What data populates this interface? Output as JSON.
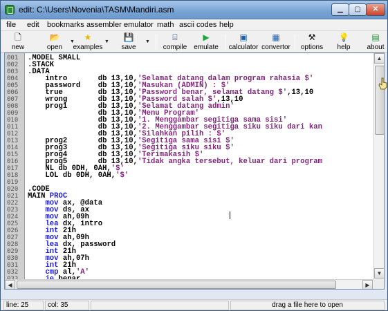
{
  "window": {
    "title": "edit: C:\\Users\\Novenia\\TASM\\Mandiri.asm",
    "minimize_icon": "minimize-icon",
    "maximize_icon": "maximize-icon",
    "close_icon": "close-icon"
  },
  "menu": [
    "file",
    "edit",
    "bookmarks",
    "assembler",
    "emulator",
    "math",
    "ascii codes",
    "help"
  ],
  "toolbar": [
    {
      "label": "new",
      "icon": "new-file-icon"
    },
    {
      "label": "open",
      "icon": "open-folder-icon"
    },
    {
      "label": "examples",
      "icon": "star-icon"
    },
    {
      "label": "save",
      "icon": "floppy-disk-icon"
    },
    {
      "label": "compile",
      "icon": "compile-icon"
    },
    {
      "label": "emulate",
      "icon": "play-icon"
    },
    {
      "label": "calculator",
      "icon": "calculator-icon"
    },
    {
      "label": "convertor",
      "icon": "convertor-icon"
    },
    {
      "label": "options",
      "icon": "tools-icon"
    },
    {
      "label": "help",
      "icon": "lightbulb-icon"
    },
    {
      "label": "about",
      "icon": "about-icon"
    }
  ],
  "colors": {
    "string": "#7d2678",
    "keyword": "#1c1cd4",
    "gutter": "#cfcfcf"
  },
  "editor": {
    "line_numbers": [
      "001",
      "002",
      "003",
      "004",
      "005",
      "006",
      "007",
      "008",
      "009",
      "010",
      "011",
      "012",
      "013",
      "014",
      "015",
      "016",
      "017",
      "018",
      "019",
      "020",
      "021",
      "022",
      "023",
      "024",
      "025",
      "026",
      "027",
      "028",
      "029",
      "030",
      "031",
      "032",
      "033",
      "034",
      "035",
      "036"
    ],
    "lines": [
      [
        {
          "t": ".MODEL SMALL"
        }
      ],
      [
        {
          "t": ".STACK"
        }
      ],
      [
        {
          "t": ".DATA"
        }
      ],
      [
        {
          "t": "    intro       db 13,10,"
        },
        {
          "t": "'Selamat datang dalam program rahasia $'",
          "s": 1
        }
      ],
      [
        {
          "t": "    password    db 13,10,"
        },
        {
          "t": "'Masukan (ADMIN) : $'",
          "s": 1
        }
      ],
      [
        {
          "t": "    true        db 13,10,"
        },
        {
          "t": "'Password benar, selamat datang $'",
          "s": 1
        },
        {
          "t": ",13,10"
        }
      ],
      [
        {
          "t": "    wrong       db 13,10,"
        },
        {
          "t": "'Password salah $'",
          "s": 1
        },
        {
          "t": ",13,10"
        }
      ],
      [
        {
          "t": "    prog1       db 13,10,"
        },
        {
          "t": "'Selamat datang admin'",
          "s": 1
        }
      ],
      [
        {
          "t": "                db 13,10,"
        },
        {
          "t": "'Menu Program'",
          "s": 1
        }
      ],
      [
        {
          "t": "                db 13,10,"
        },
        {
          "t": "'1. Menggambar segitiga sama sisi'",
          "s": 1
        }
      ],
      [
        {
          "t": "                db 13,10,"
        },
        {
          "t": "'2. Menggambar segitiga siku siku dari kan",
          "s": 1
        }
      ],
      [
        {
          "t": "                db 13,10,"
        },
        {
          "t": "'Silahkan pilih : $'",
          "s": 1
        }
      ],
      [
        {
          "t": "    prog2       db 13,10,"
        },
        {
          "t": "'Segitiga sama sisi $'",
          "s": 1
        }
      ],
      [
        {
          "t": "    prog3       db 13,10,"
        },
        {
          "t": "'Segitiga siku siku $'",
          "s": 1
        }
      ],
      [
        {
          "t": "    prog4       db 13,10,"
        },
        {
          "t": "'Terimakasih $'",
          "s": 1
        }
      ],
      [
        {
          "t": "    prog5       db 13,10,"
        },
        {
          "t": "'Tidak angka tersebut, keluar dari program",
          "s": 1
        }
      ],
      [
        {
          "t": "    NL db 0DH, 0AH,"
        },
        {
          "t": "'$'",
          "s": 1
        }
      ],
      [
        {
          "t": "    LOL db 0DH, 0AH,"
        },
        {
          "t": "'$'",
          "s": 1
        }
      ],
      [
        {
          "t": ""
        }
      ],
      [
        {
          "t": ".CODE"
        }
      ],
      [
        {
          "t": "MAIN "
        },
        {
          "t": "PROC",
          "k": 1
        }
      ],
      [
        {
          "t": "    "
        },
        {
          "t": "mov",
          "k": 1
        },
        {
          "t": " ax, @data"
        }
      ],
      [
        {
          "t": "    "
        },
        {
          "t": "mov",
          "k": 1
        },
        {
          "t": " ds, ax"
        }
      ],
      [
        {
          "t": "    "
        },
        {
          "t": "mov",
          "k": 1
        },
        {
          "t": " ah,09h"
        }
      ],
      [
        {
          "t": "    "
        },
        {
          "t": "lea",
          "k": 1
        },
        {
          "t": " dx, intro"
        }
      ],
      [
        {
          "t": "    "
        },
        {
          "t": "int",
          "k": 1
        },
        {
          "t": " 21h"
        }
      ],
      [
        {
          "t": "    "
        },
        {
          "t": "mov",
          "k": 1
        },
        {
          "t": " ah,09h"
        }
      ],
      [
        {
          "t": "    "
        },
        {
          "t": "lea",
          "k": 1
        },
        {
          "t": " dx, password"
        }
      ],
      [
        {
          "t": "    "
        },
        {
          "t": "int",
          "k": 1
        },
        {
          "t": " 21h"
        }
      ],
      [
        {
          "t": "    "
        },
        {
          "t": "mov",
          "k": 1
        },
        {
          "t": " ah,07h"
        }
      ],
      [
        {
          "t": "    "
        },
        {
          "t": "int",
          "k": 1
        },
        {
          "t": " 21h"
        }
      ],
      [
        {
          "t": "    "
        },
        {
          "t": "cmp",
          "k": 1
        },
        {
          "t": " al,"
        },
        {
          "t": "'A'",
          "s": 1
        }
      ],
      [
        {
          "t": "    "
        },
        {
          "t": "je",
          "k": 1
        },
        {
          "t": " benar"
        }
      ],
      [
        {
          "t": "    "
        },
        {
          "t": "jne",
          "k": 1
        },
        {
          "t": " salah"
        }
      ],
      [
        {
          "t": "        benar:"
        }
      ],
      [
        {
          "t": "            "
        },
        {
          "t": "mov",
          "k": 1
        },
        {
          "t": " ah,02h"
        }
      ]
    ]
  },
  "status": {
    "line": "line: 25",
    "col": "col: 35",
    "hint": "drag a file here to open"
  }
}
